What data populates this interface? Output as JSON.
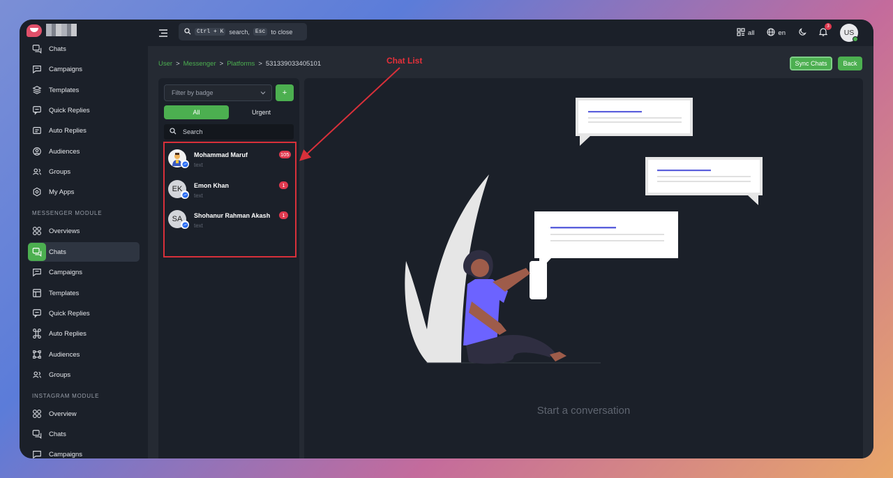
{
  "brand": {
    "logo": "chat-bubble-logo",
    "accent": "#4caf50"
  },
  "sidebar": {
    "items": [
      {
        "label": "Chats",
        "icon": "chat-icon"
      },
      {
        "label": "Campaigns",
        "icon": "campaign-icon"
      },
      {
        "label": "Templates",
        "icon": "layers-icon"
      },
      {
        "label": "Quick Replies",
        "icon": "quick-reply-icon"
      },
      {
        "label": "Auto Replies",
        "icon": "auto-reply-icon"
      },
      {
        "label": "Audiences",
        "icon": "audience-icon"
      },
      {
        "label": "Groups",
        "icon": "group-icon"
      },
      {
        "label": "My Apps",
        "icon": "apps-icon"
      }
    ],
    "messenger_section": "MESSENGER MODULE",
    "messenger_items": [
      {
        "label": "Overviews",
        "icon": "overview-icon"
      },
      {
        "label": "Chats",
        "icon": "chat-icon",
        "active": true
      },
      {
        "label": "Campaigns",
        "icon": "campaign-icon"
      },
      {
        "label": "Templates",
        "icon": "template-icon"
      },
      {
        "label": "Quick Replies",
        "icon": "quick-reply-icon"
      },
      {
        "label": "Auto Replies",
        "icon": "auto-reply-icon"
      },
      {
        "label": "Audiences",
        "icon": "audience-icon"
      },
      {
        "label": "Groups",
        "icon": "group-icon"
      }
    ],
    "instagram_section": "INSTAGRAM MODULE",
    "instagram_items": [
      {
        "label": "Overview",
        "icon": "overview-icon"
      },
      {
        "label": "Chats",
        "icon": "chat-icon"
      },
      {
        "label": "Campaigns",
        "icon": "campaign-icon"
      }
    ]
  },
  "topbar": {
    "search_key1": "Ctrl + K",
    "search_mid": "search,",
    "search_key2": "Esc",
    "search_end": "to close",
    "apps_label": "all",
    "lang_label": "en",
    "notif_count": "3",
    "user_initials": "US"
  },
  "breadcrumb": {
    "items": [
      "User",
      "Messenger",
      "Platforms"
    ],
    "sep": ">",
    "current": "531339033405101"
  },
  "actions": {
    "sync": "Sync Chats",
    "back": "Back"
  },
  "annotation": {
    "label": "Chat List",
    "color": "#d8303a"
  },
  "chat_list": {
    "filter_placeholder": "Filter by badge",
    "add": "+",
    "tabs": {
      "all": "All",
      "urgent": "Urgent"
    },
    "search_placeholder": "Search",
    "chats": [
      {
        "name": "Mohammad Maruf",
        "preview": "text",
        "count": "105",
        "initials": ""
      },
      {
        "name": "Emon Khan",
        "preview": "text",
        "count": "1",
        "initials": "EK"
      },
      {
        "name": "Shohanur Rahman Akash",
        "preview": "text",
        "count": "1",
        "initials": "SA"
      }
    ]
  },
  "conversation": {
    "empty_title": "Start a conversation"
  }
}
